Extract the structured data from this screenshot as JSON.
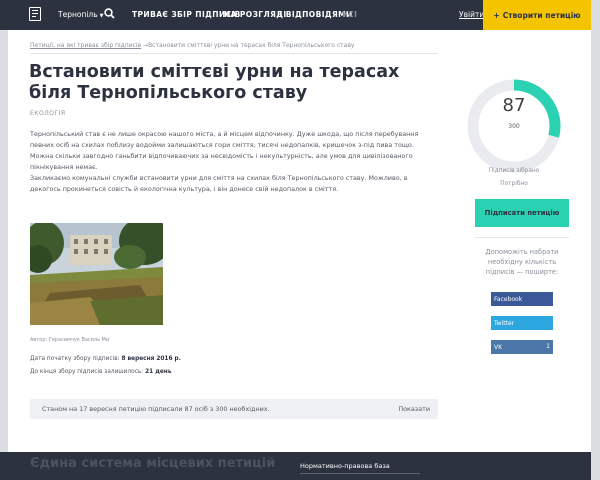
{
  "header": {
    "city": "Тернопіль",
    "nav": [
      "Триває збір підписів",
      "На розгляді",
      "З відповідями",
      "Усі"
    ],
    "login": "Увійти",
    "create_button": "Створити петицію",
    "create_icon": "+"
  },
  "breadcrumb": {
    "parent": "Петиції, на які триває збір підписів",
    "arrow": "→",
    "current": "Встановити сміттєві урни на терасах біля Тернопільського ставу"
  },
  "petition": {
    "title": "Встановити сміттєві урни на терасах біля Тернопільського ставу",
    "category": "Екологія",
    "paragraphs": [
      "Тернопільський став є не лише окрасою нашого міста, а й місцем відпочинку. Дуже шкода, що після перебування певних осіб на схилах поблизу водойми залишаються гори сміття, тисячі недопалків, кришечок з-під пива тощо. Можна скільки завгодно ганьбити відпочиваючих за несвідомість і некультурність, але умов для цивілізованого пікнікування немає.",
      "Закликаємо комунальні служби встановити урни для сміття на схилах біля Тернопільського ставу. Можливо, в декогось прокинеться совість й екологічна культура, і він донесе свій недопалок в сміття."
    ],
    "photo_author": "Автор: Герасимчук Василь Ми",
    "start_label": "Дата початку збору підписів:",
    "start_date": "8 вересня 2016 р.",
    "remaining_label": "До кінця збору підписів залишилось:",
    "remaining_value": "21 день",
    "status_text": "Станом на 17 вересня петицію підписали 87 осіб з 300 необхідних.",
    "show_label": "Показати"
  },
  "sidebar": {
    "signatures": "87",
    "required": "300",
    "progress_fraction": 0.29,
    "collected_label": "Підписів зібрано",
    "needed_label": "Потрібно",
    "sign_button": "Підписати петицію",
    "help_text": "Допоможіть набрати необхідну кількість підписів — поширте:",
    "share": [
      {
        "label": "Facebook",
        "count": ""
      },
      {
        "label": "Twitter",
        "count": ""
      },
      {
        "label": "VK",
        "count": "1"
      }
    ]
  },
  "footer": {
    "title": "Єдина система місцевих петицій",
    "link": "Нормативно-правова база"
  },
  "colors": {
    "navbar": "#2d3240",
    "accent_yellow": "#f5c400",
    "accent_teal": "#2ad1b2",
    "facebook": "#3b5998",
    "twitter": "#2ca7e0",
    "vk": "#4a76a8"
  }
}
